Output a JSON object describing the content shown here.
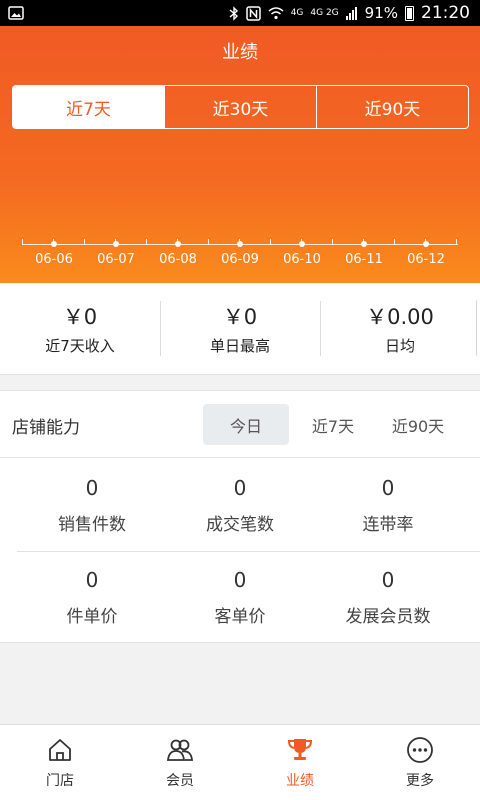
{
  "status_bar": {
    "network_4g": "4G",
    "network_4g_2g": "4G 2G",
    "battery": "91%",
    "time": "21:20"
  },
  "header": {
    "title": "业绩",
    "range_tabs": [
      "近7天",
      "近30天",
      "近90天"
    ],
    "active_range": "近7天"
  },
  "chart_data": {
    "type": "line",
    "x": [
      "06-06",
      "06-07",
      "06-08",
      "06-09",
      "06-10",
      "06-11",
      "06-12"
    ],
    "series": [
      {
        "values": [
          0,
          0,
          0,
          0,
          0,
          0,
          0
        ]
      }
    ]
  },
  "summary": [
    {
      "value": "￥0",
      "label": "近7天收入"
    },
    {
      "value": "￥0",
      "label": "单日最高"
    },
    {
      "value": "￥0.00",
      "label": "日均"
    }
  ],
  "capability": {
    "title": "店铺能力",
    "tabs": [
      "今日",
      "近7天",
      "近90天"
    ],
    "active_tab": "今日",
    "metrics": [
      {
        "value": "0",
        "label": "销售件数"
      },
      {
        "value": "0",
        "label": "成交笔数"
      },
      {
        "value": "0",
        "label": "连带率"
      },
      {
        "value": "0",
        "label": "件单价"
      },
      {
        "value": "0",
        "label": "客单价"
      },
      {
        "value": "0",
        "label": "发展会员数"
      }
    ]
  },
  "bottom_nav": [
    {
      "label": "门店",
      "icon": "store-icon"
    },
    {
      "label": "会员",
      "icon": "members-icon"
    },
    {
      "label": "业绩",
      "icon": "trophy-icon"
    },
    {
      "label": "更多",
      "icon": "more-icon"
    }
  ],
  "bottom_nav_active": "业绩",
  "colors": {
    "accent": "#f05a24",
    "accent_light": "#f98b1c",
    "text": "#333333",
    "tab_active_bg": "#e8ecef"
  }
}
